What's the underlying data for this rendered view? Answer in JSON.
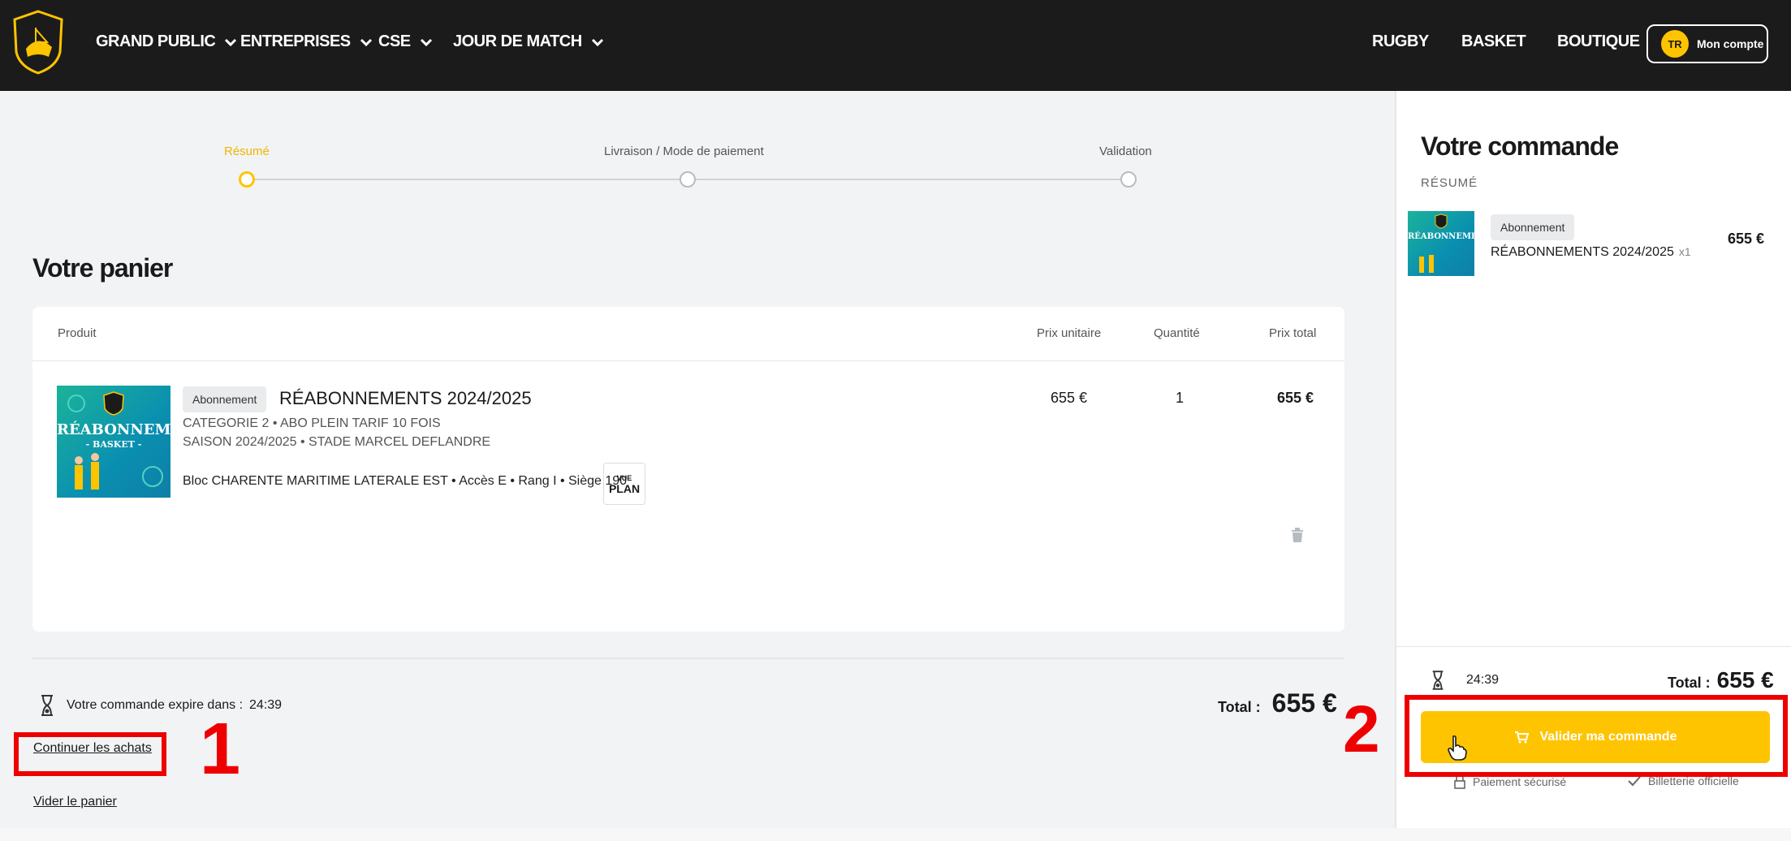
{
  "header": {
    "nav": [
      "GRAND PUBLIC",
      "ENTREPRISES",
      "CSE",
      "JOUR DE MATCH"
    ],
    "right_nav": [
      "RUGBY",
      "BASKET",
      "BOUTIQUE"
    ],
    "account": {
      "initials": "TR",
      "label": "Mon compte"
    },
    "logo_text": "STADE ROCHELAIS"
  },
  "steps": [
    {
      "label": "Résumé",
      "active": true
    },
    {
      "label": "Livraison / Mode de paiement",
      "active": false
    },
    {
      "label": "Validation",
      "active": false
    }
  ],
  "cart": {
    "title": "Votre panier",
    "columns": {
      "product": "Produit",
      "unit_price": "Prix unitaire",
      "quantity": "Quantité",
      "total_price": "Prix total"
    },
    "item": {
      "thumb_title": "RÉABONNEMENTS",
      "thumb_sub": "- BASKET -",
      "badge": "Abonnement",
      "name": "RÉABONNEMENTS 2024/2025",
      "line1": "CATEGORIE 2 • ABO PLEIN TARIF 10 FOIS",
      "line2": "SAISON 2024/2025 • STADE MARCEL DEFLANDRE",
      "location": "Bloc CHARENTE MARITIME LATERALE EST • Accès E • Rang I • Siège 190",
      "vue_top": "VUE",
      "vue_bottom": "PLAN",
      "unit_price": "655 €",
      "quantity": "1",
      "total_price": "655 €"
    },
    "expire_label": "Votre commande expire dans :",
    "expire_time": "24:39",
    "total_label": "Total :",
    "total_value": "655 €",
    "continue_link": "Continuer les achats",
    "empty_link": "Vider le panier"
  },
  "annotations": {
    "one": "1",
    "two": "2"
  },
  "sidebar": {
    "title": "Votre commande",
    "subtitle": "RÉSUMÉ",
    "badge": "Abonnement",
    "product": "RÉABONNEMENTS 2024/2025",
    "qty": "x1",
    "price": "655 €",
    "timer": "24:39",
    "total_label": "Total :",
    "total_value": "655 €",
    "validate_button": "Valider ma commande",
    "secure_payment": "Paiement sécurisé",
    "official_ticketing": "Billetterie officielle"
  },
  "colors": {
    "accent": "#ffc400",
    "header_bg": "#1b1b1b",
    "annotation": "#ee0000"
  }
}
